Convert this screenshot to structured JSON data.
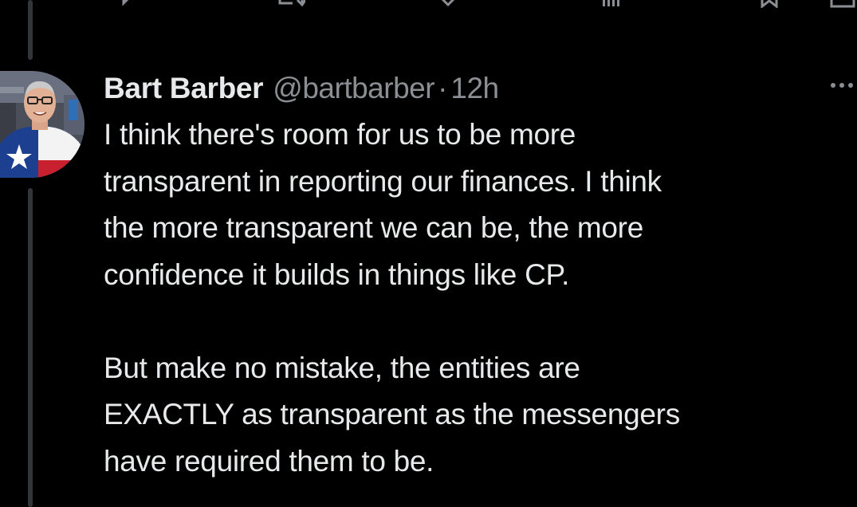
{
  "actions": [
    {
      "name": "reply",
      "icon": "reply-icon"
    },
    {
      "name": "retweet",
      "icon": "retweet-icon"
    },
    {
      "name": "like",
      "icon": "heart-icon"
    },
    {
      "name": "views",
      "icon": "bar-chart-icon"
    },
    {
      "name": "bookmark",
      "icon": "bookmark-icon"
    },
    {
      "name": "share",
      "icon": "share-icon"
    }
  ],
  "tweet": {
    "display_name": "Bart Barber",
    "handle": "@bartbarber",
    "separator": "·",
    "time": "12h",
    "paragraph_1": "I think there's room for us to be more\ntransparent in reporting our finances. I think\nthe more transparent we can be, the more\nconfidence it builds in things like CP.",
    "paragraph_2": "But make no mistake, the entities are\nEXACTLY as transparent as the messengers\nhave required them to be."
  },
  "colors": {
    "background": "#000000",
    "text_primary": "#e7e9ea",
    "text_secondary": "#8b8f94",
    "thread_line": "#333639"
  }
}
